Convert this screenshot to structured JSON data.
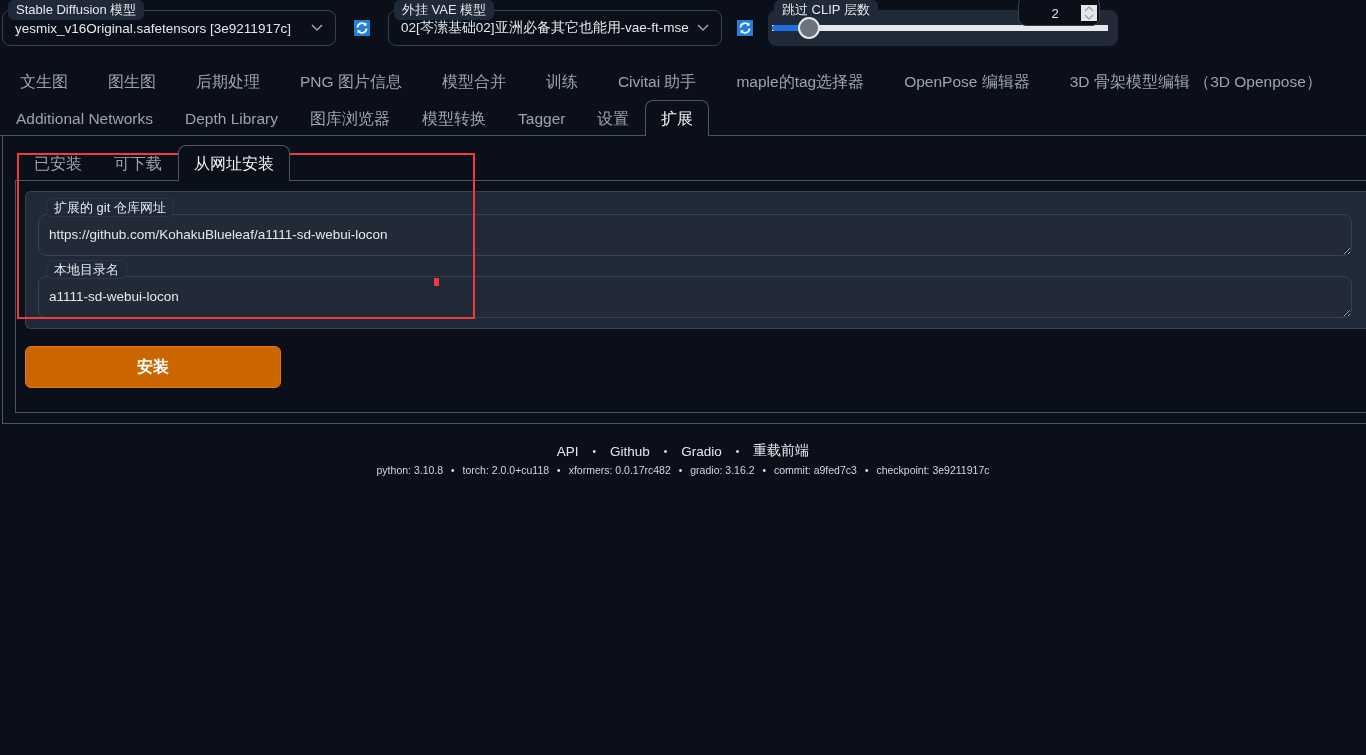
{
  "top_bar": {
    "model": {
      "label": "Stable Diffusion 模型",
      "value": "yesmix_v16Original.safetensors [3e9211917c]"
    },
    "vae": {
      "label": "外挂 VAE 模型",
      "value": "02[芩潆基础02]亚洲必备其它也能用-vae-ft-mse"
    },
    "clip_skip": {
      "label": "跳过 CLIP 层数",
      "value": "2",
      "level": 0.11
    }
  },
  "tabs": [
    {
      "label": "文生图",
      "selected": false
    },
    {
      "label": "图生图",
      "selected": false
    },
    {
      "label": "后期处理",
      "selected": false
    },
    {
      "label": "PNG 图片信息",
      "selected": false
    },
    {
      "label": "模型合并",
      "selected": false
    },
    {
      "label": "训练",
      "selected": false
    },
    {
      "label": "Civitai 助手",
      "selected": false
    },
    {
      "label": "maple的tag选择器",
      "selected": false
    },
    {
      "label": "OpenPose 编辑器",
      "selected": false
    },
    {
      "label": "3D 骨架模型编辑 （3D Openpose）",
      "selected": false
    },
    {
      "label": "Additional Networks",
      "selected": false
    },
    {
      "label": "Depth Library",
      "selected": false
    },
    {
      "label": "图库浏览器",
      "selected": false
    },
    {
      "label": "模型转换",
      "selected": false
    },
    {
      "label": "Tagger",
      "selected": false
    },
    {
      "label": "设置",
      "selected": false
    },
    {
      "label": "扩展",
      "selected": true
    }
  ],
  "sub_tabs": [
    {
      "label": "已安装",
      "selected": false
    },
    {
      "label": "可下载",
      "selected": false
    },
    {
      "label": "从网址安装",
      "selected": true
    }
  ],
  "install": {
    "url": {
      "label": "扩展的 git 仓库网址",
      "value": "https://github.com/KohakuBlueleaf/a1111-sd-webui-locon"
    },
    "dir": {
      "label": "本地目录名",
      "value": "a1111-sd-webui-locon"
    },
    "button": "安装"
  },
  "annotations": {
    "frame": true,
    "mark": true
  },
  "footer": {
    "links": [
      {
        "kind": "link",
        "text": "API"
      },
      {
        "kind": "separator",
        "text": "•"
      },
      {
        "kind": "link",
        "text": "Github"
      },
      {
        "kind": "separator",
        "text": "•"
      },
      {
        "kind": "link",
        "text": "Gradio"
      },
      {
        "kind": "separator",
        "text": "•"
      },
      {
        "kind": "link",
        "text": "重载前端"
      }
    ],
    "versions": [
      {
        "kind": "info",
        "text": "python: 3.10.8"
      },
      {
        "kind": "separator",
        "text": "•"
      },
      {
        "kind": "info",
        "text": "torch: 2.0.0+cu118"
      },
      {
        "kind": "separator",
        "text": "•"
      },
      {
        "kind": "info",
        "text": "xformers: 0.0.17rc482"
      },
      {
        "kind": "separator",
        "text": "•"
      },
      {
        "kind": "info",
        "text": "gradio: 3.16.2"
      },
      {
        "kind": "separator",
        "text": "•"
      },
      {
        "kind": "info",
        "text": "commit: a9fed7c3"
      },
      {
        "kind": "separator",
        "text": "•"
      },
      {
        "kind": "info",
        "text": "checkpoint: 3e9211917c"
      }
    ]
  }
}
